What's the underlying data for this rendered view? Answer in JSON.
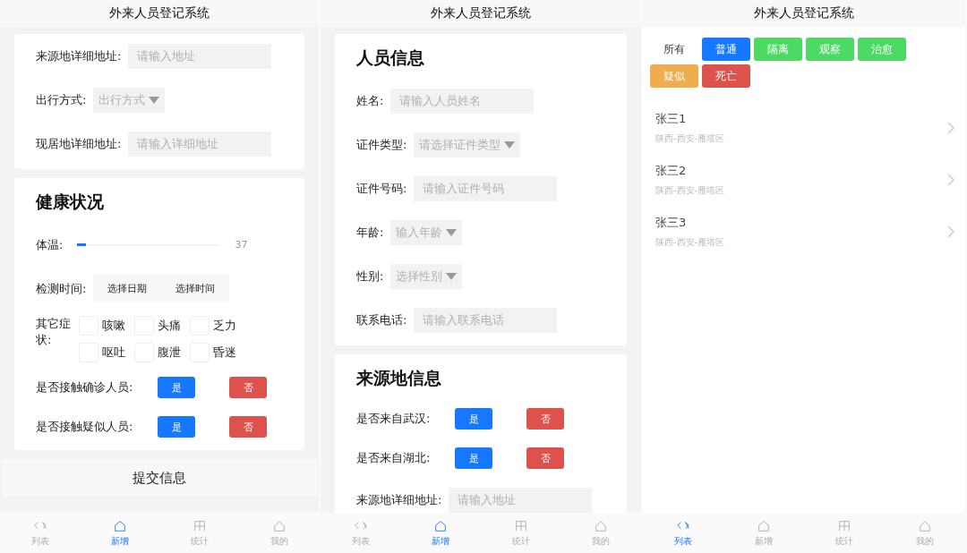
{
  "screens": [
    {
      "kind": "form",
      "title": "外来人员登记系统",
      "sections": [
        {
          "rows": [
            {
              "kind": "input",
              "label": "来源地详细地址:",
              "placeholder": "请输入地址"
            },
            {
              "kind": "select",
              "label": "出行方式:",
              "placeholder": "出行方式"
            },
            {
              "kind": "input",
              "label": "现居地详细地址:",
              "placeholder": "请输入详细地址"
            }
          ]
        },
        {
          "heading": "健康状况",
          "rows": [
            {
              "kind": "slider",
              "label": "体温:",
              "level": 0.05,
              "reading": "37"
            },
            {
              "kind": "datetime",
              "label": "检测时间:",
              "buttons": [
                "选择日期",
                "选择时间"
              ]
            },
            {
              "kind": "checks",
              "label": "其它症状:",
              "options": [
                {
                  "label": "咳嗽",
                  "checked": false
                },
                {
                  "label": "头痛",
                  "checked": false
                },
                {
                  "label": "乏力",
                  "checked": false
                },
                {
                  "label": "呕吐",
                  "checked": false
                },
                {
                  "label": "腹泄",
                  "checked": false
                },
                {
                  "label": "昏迷",
                  "checked": false
                }
              ]
            },
            {
              "kind": "yesno",
              "label": "是否接触确诊人员:",
              "yes": "是",
              "no": "否"
            },
            {
              "kind": "yesno",
              "label": "是否接触疑似人员:",
              "yes": "是",
              "no": "否"
            }
          ]
        }
      ],
      "submit": "提交信息",
      "tabs": [
        {
          "label": "列表",
          "selected": false
        },
        {
          "label": "新增",
          "selected": true
        },
        {
          "label": "统计",
          "selected": false
        },
        {
          "label": "我的",
          "selected": false
        }
      ]
    },
    {
      "kind": "form",
      "title": "外来人员登记系统",
      "sections": [
        {
          "heading": "人员信息",
          "rows": [
            {
              "kind": "input",
              "label": "姓名:",
              "placeholder": "请输入人员姓名"
            },
            {
              "kind": "select",
              "label": "证件类型:",
              "placeholder": "请选择证件类型"
            },
            {
              "kind": "input",
              "label": "证件号码:",
              "placeholder": "请输入证件号码"
            },
            {
              "kind": "select",
              "label": "年龄:",
              "placeholder": "输入年龄"
            },
            {
              "kind": "select",
              "label": "性别:",
              "placeholder": "选择性别"
            },
            {
              "kind": "input",
              "label": "联系电话:",
              "placeholder": "请输入联系电话"
            }
          ]
        },
        {
          "heading": "来源地信息",
          "rows": [
            {
              "kind": "yesno",
              "label": "是否来自武汉:",
              "yes": "是",
              "no": "否"
            },
            {
              "kind": "yesno",
              "label": "是否来自湖北:",
              "yes": "是",
              "no": "否"
            },
            {
              "kind": "input",
              "label": "来源地详细地址:",
              "placeholder": "请输入地址"
            }
          ]
        }
      ],
      "tabs": [
        {
          "label": "列表",
          "selected": false
        },
        {
          "label": "新增",
          "selected": true
        },
        {
          "label": "统计",
          "selected": false
        },
        {
          "label": "我的",
          "selected": false
        }
      ]
    },
    {
      "kind": "list",
      "title": "外来人员登记系统",
      "filters": [
        {
          "label": "所有",
          "color": "#ffffff"
        },
        {
          "label": "普通",
          "color": "#1677ff"
        },
        {
          "label": "隔离",
          "color": "#4cd964"
        },
        {
          "label": "观察",
          "color": "#4cd964"
        },
        {
          "label": "治愈",
          "color": "#4cd964"
        },
        {
          "label": "疑似",
          "color": "#f0ad4e"
        },
        {
          "label": "死亡",
          "color": "#dd524d"
        }
      ],
      "people": [
        {
          "name": "张三1",
          "place": "陕西-西安-雁塔区"
        },
        {
          "name": "张三2",
          "place": "陕西-西安-雁塔区"
        },
        {
          "name": "张三3",
          "place": "陕西-西安-雁塔区"
        }
      ],
      "tabs": [
        {
          "label": "列表",
          "selected": true
        },
        {
          "label": "新增",
          "selected": false
        },
        {
          "label": "统计",
          "selected": false
        },
        {
          "label": "我的",
          "selected": false
        }
      ]
    }
  ]
}
